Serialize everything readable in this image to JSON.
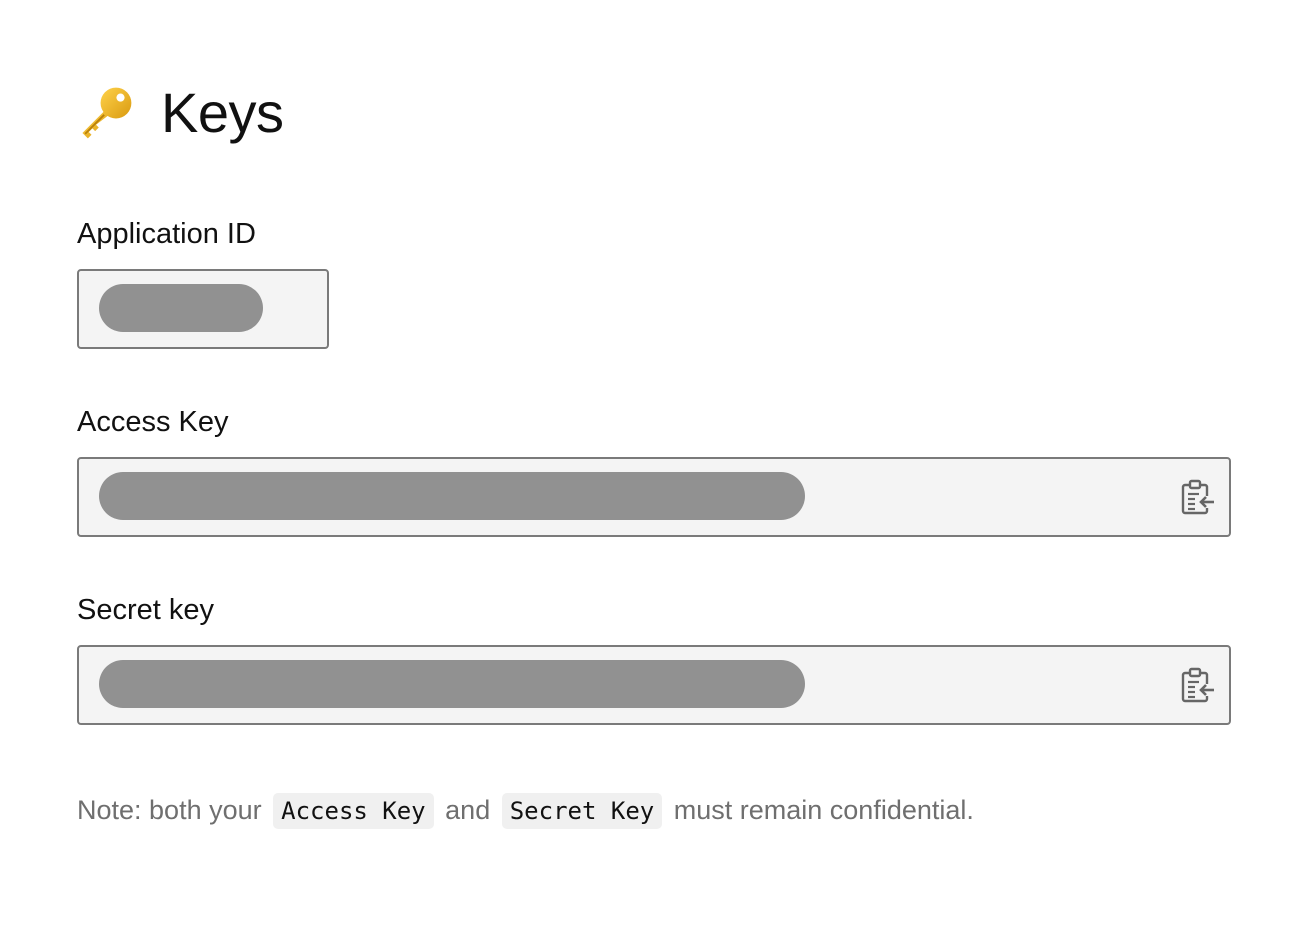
{
  "header": {
    "title": "Keys",
    "icon": "key-icon"
  },
  "fields": {
    "application_id": {
      "label": "Application ID",
      "value_redacted": true
    },
    "access_key": {
      "label": "Access Key",
      "value_redacted": true,
      "copy_icon": "clipboard-copy-icon"
    },
    "secret_key": {
      "label": "Secret key",
      "value_redacted": true,
      "copy_icon": "clipboard-copy-icon"
    }
  },
  "note": {
    "prefix": "Note: both your",
    "code1": "Access Key",
    "middle": "and",
    "code2": "Secret Key",
    "suffix": "must remain confidential."
  },
  "colors": {
    "field_background": "#f4f4f4",
    "field_border": "#7a7a7a",
    "redaction": "#919191",
    "note_text": "#6f6f6f",
    "key_gold": "#e8b21e"
  }
}
